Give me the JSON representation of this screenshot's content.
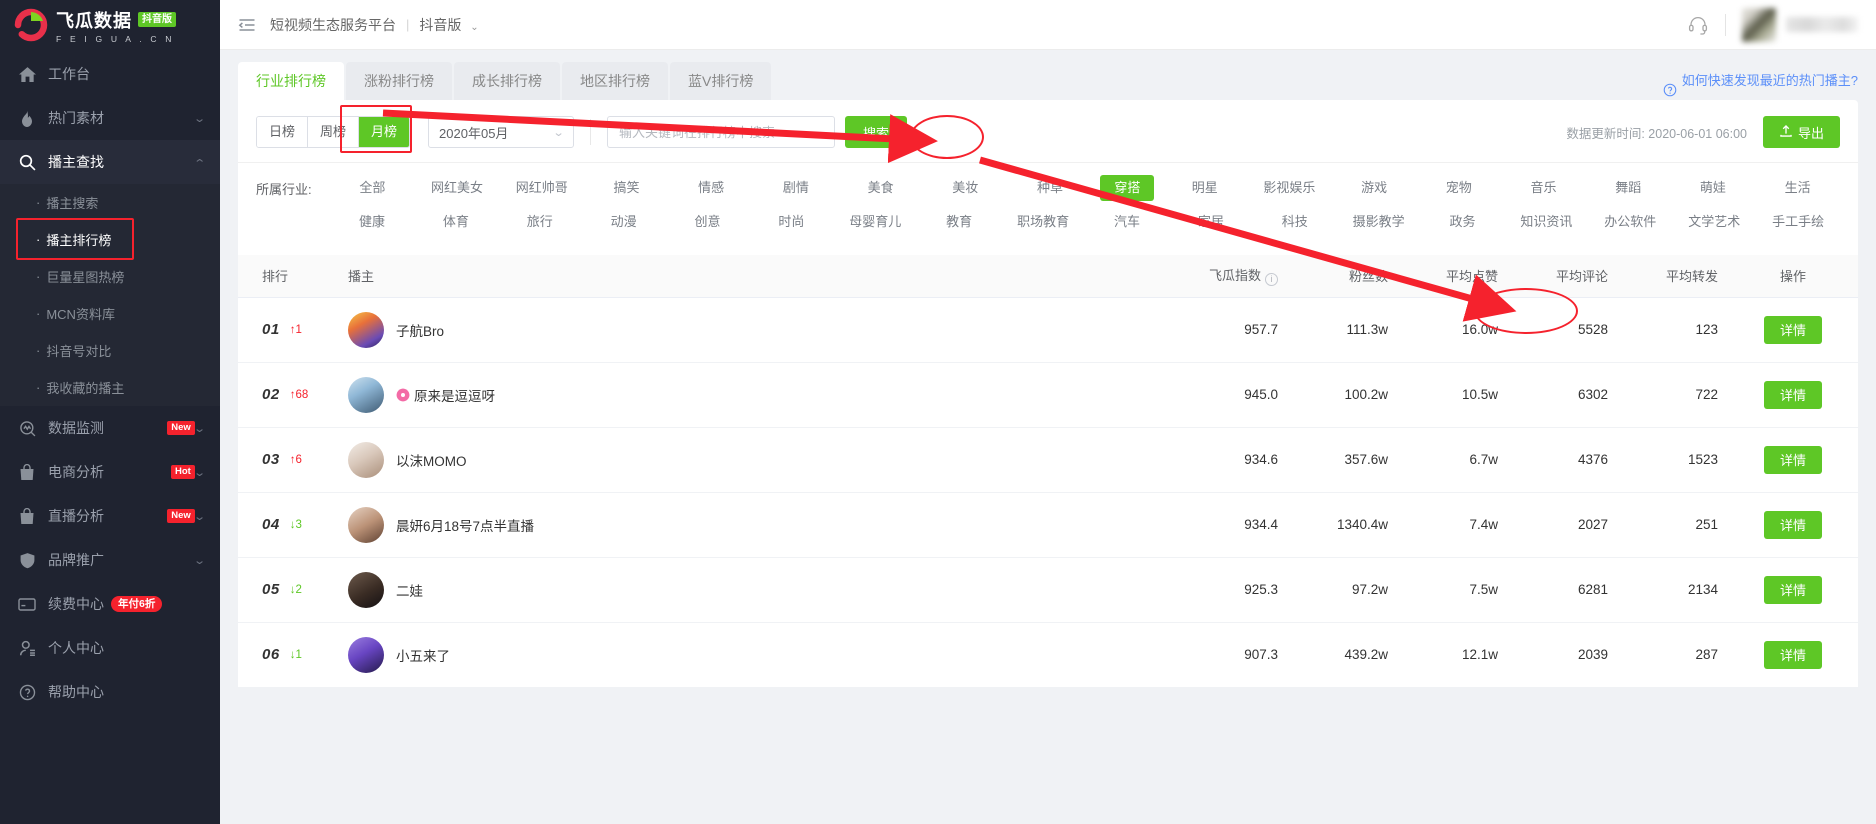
{
  "brand": {
    "name": "飞瓜数据",
    "badge": "抖音版",
    "domain": "F E I G U A . C N",
    "logo_colors": {
      "red": "#e8304a",
      "green": "#7ed321"
    }
  },
  "accent": {
    "green": "#5ec726",
    "red": "#f5222d",
    "blue": "#5b8ff9"
  },
  "sidebar": {
    "items": [
      {
        "label": "工作台",
        "icon": "home-icon",
        "expandable": false
      },
      {
        "label": "热门素材",
        "icon": "fire-icon",
        "expandable": true
      },
      {
        "label": "播主查找",
        "icon": "search-icon",
        "expandable": true,
        "active": true
      }
    ],
    "submenu": [
      {
        "label": "播主搜索"
      },
      {
        "label": "播主排行榜",
        "current": true
      },
      {
        "label": "巨量星图热榜"
      },
      {
        "label": "MCN资料库"
      },
      {
        "label": "抖音号对比"
      },
      {
        "label": "我收藏的播主"
      }
    ],
    "items_lower": [
      {
        "label": "数据监测",
        "icon": "monitor-icon",
        "tag": "New",
        "expandable": true
      },
      {
        "label": "电商分析",
        "icon": "bag-icon",
        "tag": "Hot",
        "expandable": true
      },
      {
        "label": "直播分析",
        "icon": "bag-icon",
        "tag": "New",
        "expandable": true
      },
      {
        "label": "品牌推广",
        "icon": "shield-icon",
        "tag": "",
        "expandable": true
      },
      {
        "label": "续费中心",
        "icon": "card-icon",
        "tag": "年付6折",
        "expandable": false
      },
      {
        "label": "个人中心",
        "icon": "user-icon",
        "tag": "",
        "expandable": false
      },
      {
        "label": "帮助中心",
        "icon": "question-icon",
        "tag": "",
        "expandable": false
      }
    ]
  },
  "topbar": {
    "collapse_icon": "collapse-menu-icon",
    "title": "短视频生态服务平台",
    "separator": "|",
    "platform": "抖音版",
    "headset_icon": "headset-icon"
  },
  "tabs": [
    {
      "label": "行业排行榜",
      "active": true
    },
    {
      "label": "涨粉排行榜",
      "active": false
    },
    {
      "label": "成长排行榜",
      "active": false
    },
    {
      "label": "地区排行榜",
      "active": false
    },
    {
      "label": "蓝V排行榜",
      "active": false
    }
  ],
  "help_link": "如何快速发现最近的热门播主?",
  "filters": {
    "period": [
      {
        "label": "日榜",
        "active": false
      },
      {
        "label": "周榜",
        "active": false
      },
      {
        "label": "月榜",
        "active": true
      }
    ],
    "date_value": "2020年05月",
    "search_placeholder": "输入关键词在排行榜中搜索",
    "search_value": "",
    "search_button": "搜索",
    "update_time": "数据更新时间: 2020-06-01 06:00",
    "export_button": "导出"
  },
  "categories": {
    "label": "所属行业:",
    "row1": [
      "全部",
      "网红美女",
      "网红帅哥",
      "搞笑",
      "情感",
      "剧情",
      "美食",
      "美妆",
      "种草",
      "穿搭",
      "明星",
      "影视娱乐",
      "游戏",
      "宠物",
      "音乐",
      "舞蹈",
      "萌娃",
      "生活"
    ],
    "row2": [
      "健康",
      "体育",
      "旅行",
      "动漫",
      "创意",
      "时尚",
      "母婴育儿",
      "教育",
      "职场教育",
      "汽车",
      "家居",
      "科技",
      "摄影教学",
      "政务",
      "知识资讯",
      "办公软件",
      "文学艺术",
      "手工手绘"
    ],
    "active": "穿搭"
  },
  "table": {
    "headers": [
      "排行",
      "播主",
      "飞瓜指数",
      "粉丝数",
      "平均点赞",
      "平均评论",
      "平均转发",
      "操作"
    ],
    "action_label": "详情",
    "rows": [
      {
        "rank": "01",
        "delta": "1",
        "delta_dir": "up",
        "name": "子航Bro",
        "badge": "",
        "index": "957.7",
        "fans": "111.3w",
        "likes": "16.0w",
        "comments": "5528",
        "shares": "123",
        "avatar_from": "#f5b942",
        "avatar_to": "#7a5cc6"
      },
      {
        "rank": "02",
        "delta": "68",
        "delta_dir": "up",
        "name": "原来是逗逗呀",
        "badge": "flower-icon",
        "index": "945.0",
        "fans": "100.2w",
        "likes": "10.5w",
        "comments": "6302",
        "shares": "722",
        "avatar_from": "#8fb7d6",
        "avatar_to": "#3e5a72"
      },
      {
        "rank": "03",
        "delta": "6",
        "delta_dir": "up",
        "name": "以沫MOMO",
        "badge": "",
        "index": "934.6",
        "fans": "357.6w",
        "likes": "6.7w",
        "comments": "4376",
        "shares": "1523",
        "avatar_from": "#e8e0d8",
        "avatar_to": "#b9a493"
      },
      {
        "rank": "04",
        "delta": "3",
        "delta_dir": "down",
        "name": "晨妍6月18号7点半直播",
        "badge": "",
        "index": "934.4",
        "fans": "1340.4w",
        "likes": "7.4w",
        "comments": "2027",
        "shares": "251",
        "avatar_from": "#c8b2a0",
        "avatar_to": "#6b4f3f"
      },
      {
        "rank": "05",
        "delta": "2",
        "delta_dir": "down",
        "name": "二娃",
        "badge": "",
        "index": "925.3",
        "fans": "97.2w",
        "likes": "7.5w",
        "comments": "6281",
        "shares": "2134",
        "avatar_from": "#4a3c34",
        "avatar_to": "#241c18"
      },
      {
        "rank": "06",
        "delta": "1",
        "delta_dir": "down",
        "name": "小五来了",
        "badge": "",
        "index": "907.3",
        "fans": "439.2w",
        "likes": "12.1w",
        "comments": "2039",
        "shares": "287",
        "avatar_from": "#7b5fc9",
        "avatar_to": "#2d2150"
      }
    ]
  },
  "annotations": {
    "highlight_color": "#f5222d",
    "targets": [
      "播主排行榜",
      "月榜",
      "穿搭",
      "详情"
    ]
  }
}
